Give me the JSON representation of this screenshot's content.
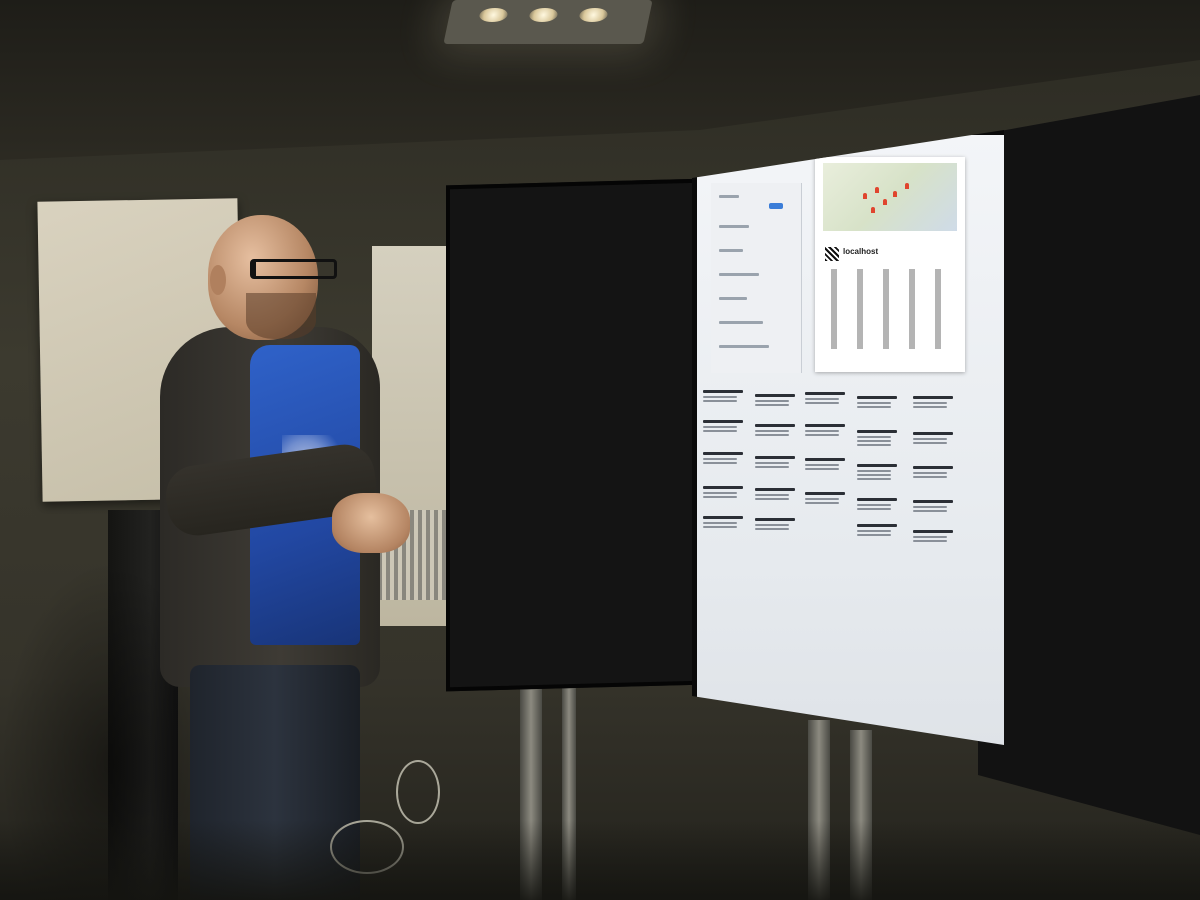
{
  "scene": {
    "screen_heading": "localhost",
    "directory_text_visible": false
  },
  "colors": {
    "wall": "#3c3a2f",
    "screen": "#f3f5f8",
    "shirt": "#2248a3",
    "print_button": "#3b7dd8",
    "map_pin": "#e0452e"
  }
}
